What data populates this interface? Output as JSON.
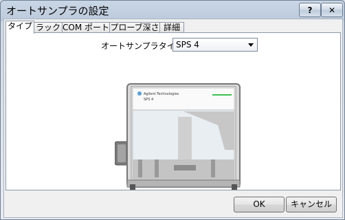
{
  "window": {
    "title": "オートサンプラの設定"
  },
  "titlebar": {
    "help_label": "?",
    "close_label": "✕"
  },
  "tabs": [
    {
      "label": "タイプ",
      "active": true
    },
    {
      "label": "ラック",
      "active": false
    },
    {
      "label": "COM ポート",
      "active": false
    },
    {
      "label": "プローブ深さ",
      "active": false
    },
    {
      "label": "詳細",
      "active": false
    }
  ],
  "type_panel": {
    "label": "オートサンプラタイプ:",
    "selected": "SPS 4",
    "device_brand": "Agilent Technologies",
    "device_model": "SPS 4"
  },
  "buttons": {
    "ok": "OK",
    "cancel": "キャンセル"
  }
}
